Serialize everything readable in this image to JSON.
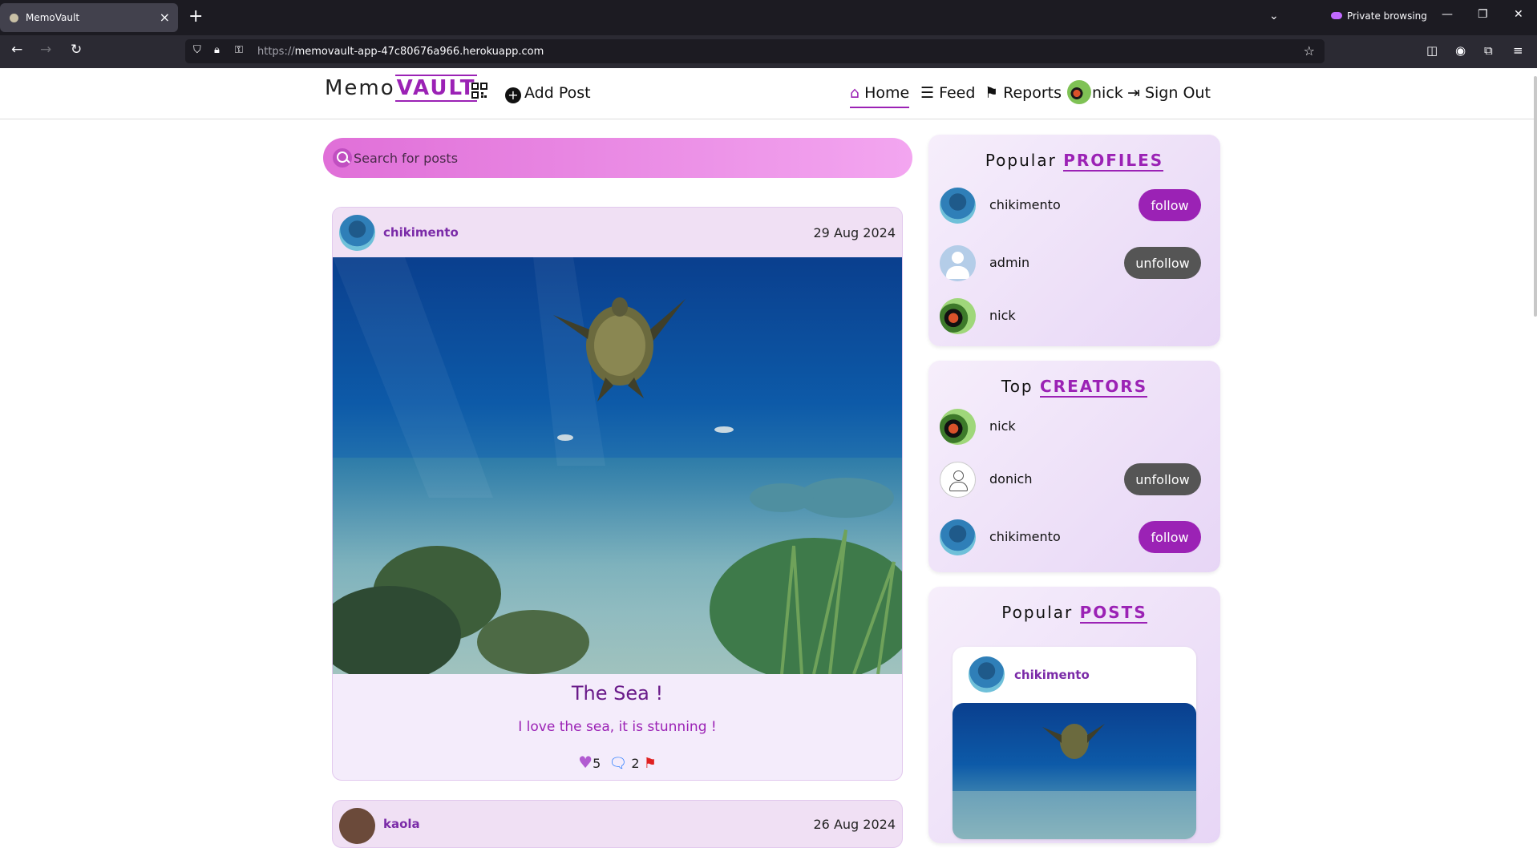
{
  "browser": {
    "tab_title": "MemoVault",
    "private_label": "Private browsing",
    "url_prefix": "https://",
    "url_host": "memovault-app-47c80676a966.herokuapp.com"
  },
  "header": {
    "logo_memo": "Memo",
    "logo_vault": "VAULT",
    "add_post": "Add Post",
    "nav": {
      "home": "Home",
      "feed": "Feed",
      "reports": "Reports",
      "user": "nick",
      "sign_out": "Sign Out"
    }
  },
  "search": {
    "placeholder": "Search for posts"
  },
  "posts": [
    {
      "user": "chikimento",
      "date": "29 Aug 2024",
      "title": "The Sea !",
      "description": "I love the sea, it is stunning !",
      "likes": "5",
      "comments": "2"
    },
    {
      "user": "kaola",
      "date": "26 Aug 2024"
    }
  ],
  "popular_profiles": {
    "title_plain": "Popular",
    "title_highlight": "PROFILES",
    "items": [
      {
        "name": "chikimento",
        "action": "follow"
      },
      {
        "name": "admin",
        "action": "unfollow"
      },
      {
        "name": "nick",
        "action": ""
      }
    ]
  },
  "top_creators": {
    "title_plain": "Top",
    "title_highlight": "CREATORS",
    "items": [
      {
        "name": "nick",
        "action": ""
      },
      {
        "name": "donich",
        "action": "unfollow"
      },
      {
        "name": "chikimento",
        "action": "follow"
      }
    ]
  },
  "popular_posts": {
    "title_plain": "Popular",
    "title_highlight": "POSTS",
    "items": [
      {
        "user": "chikimento"
      }
    ]
  },
  "colors": {
    "brand": "#9b22b5",
    "unfollow": "#555555",
    "like": "#b15bd1",
    "comment": "#1f75fe",
    "report_flag": "#e02020"
  }
}
